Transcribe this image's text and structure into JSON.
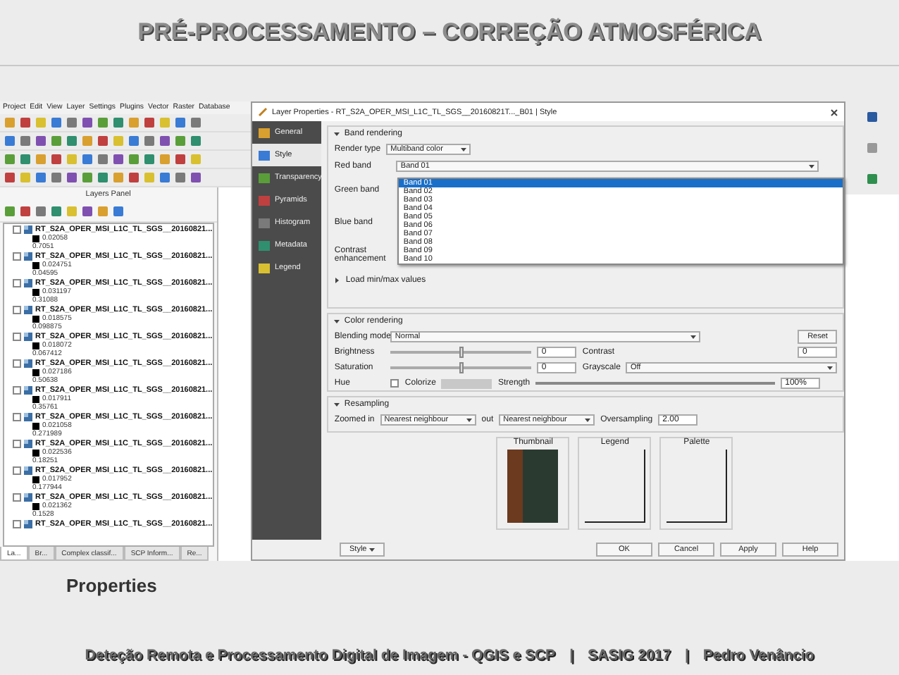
{
  "slide": {
    "title": "PRÉ-PROCESSAMENTO – CORREÇÃO ATMOSFÉRICA",
    "caption": "Properties",
    "footer": [
      "Deteção Remota e Processamento Digital de Imagem - QGIS e SCP",
      "|",
      "SASIG 2017",
      "|",
      "Pedro Venâncio"
    ]
  },
  "qgis": {
    "menu": [
      "Project",
      "Edit",
      "View",
      "Layer",
      "Settings",
      "Plugins",
      "Vector",
      "Raster",
      "Database"
    ],
    "layers_panel": {
      "title": "Layers Panel",
      "layers": [
        {
          "name": "RT_S2A_OPER_MSI_L1C_TL_SGS__20160821...",
          "checked": false,
          "values": [
            "0.02058",
            "0.7051"
          ]
        },
        {
          "name": "RT_S2A_OPER_MSI_L1C_TL_SGS__20160821...",
          "checked": false,
          "values": [
            "0.024751",
            "0.04595"
          ]
        },
        {
          "name": "RT_S2A_OPER_MSI_L1C_TL_SGS__20160821...",
          "checked": false,
          "values": [
            "0.031197",
            "0.31088"
          ]
        },
        {
          "name": "RT_S2A_OPER_MSI_L1C_TL_SGS__20160821...",
          "checked": false,
          "values": [
            "0.018575",
            "0.098875"
          ]
        },
        {
          "name": "RT_S2A_OPER_MSI_L1C_TL_SGS__20160821...",
          "checked": false,
          "values": [
            "0.018072",
            "0.067412"
          ]
        },
        {
          "name": "RT_S2A_OPER_MSI_L1C_TL_SGS__20160821...",
          "checked": false,
          "values": [
            "0.027186",
            "0.50638"
          ]
        },
        {
          "name": "RT_S2A_OPER_MSI_L1C_TL_SGS__20160821...",
          "checked": false,
          "values": [
            "0.017911",
            "0.35761"
          ]
        },
        {
          "name": "RT_S2A_OPER_MSI_L1C_TL_SGS__20160821...",
          "checked": false,
          "values": [
            "0.021058",
            "0.271989"
          ]
        },
        {
          "name": "RT_S2A_OPER_MSI_L1C_TL_SGS__20160821...",
          "checked": false,
          "values": [
            "0.022536",
            "0.18251"
          ]
        },
        {
          "name": "RT_S2A_OPER_MSI_L1C_TL_SGS__20160821...",
          "checked": false,
          "values": [
            "0.017952",
            "0.177944"
          ]
        },
        {
          "name": "RT_S2A_OPER_MSI_L1C_TL_SGS__20160821...",
          "checked": false,
          "values": [
            "0.021362",
            "0.1528"
          ]
        },
        {
          "name": "RT_S2A_OPER_MSI_L1C_TL_SGS__20160821...",
          "checked": false
        }
      ],
      "tabs": [
        {
          "label": "La...",
          "selected": true
        },
        {
          "label": "Br...",
          "selected": false
        },
        {
          "label": "Complex classif...",
          "selected": false
        },
        {
          "label": "SCP Inform...",
          "selected": false
        },
        {
          "label": "Re...",
          "selected": false
        }
      ]
    }
  },
  "dialog": {
    "title": "Layer Properties - RT_S2A_OPER_MSI_L1C_TL_SGS__20160821T..._B01 | Style",
    "sidebar": [
      {
        "label": "General",
        "selected": false
      },
      {
        "label": "Style",
        "selected": true
      },
      {
        "label": "Transparency",
        "selected": false
      },
      {
        "label": "Pyramids",
        "selected": false
      },
      {
        "label": "Histogram",
        "selected": false
      },
      {
        "label": "Metadata",
        "selected": false
      },
      {
        "label": "Legend",
        "selected": false
      }
    ],
    "band_rendering": {
      "title": "Band rendering",
      "render_type_label": "Render type",
      "render_type": "Multiband color",
      "rows": [
        {
          "label": "Red band",
          "value": "Band 01"
        },
        {
          "label": "Green band"
        },
        {
          "label": "Blue band"
        },
        {
          "label": "Contrast enhancement"
        }
      ],
      "band_options": [
        {
          "label": "Band 01",
          "selected": true
        },
        {
          "label": "Band 02",
          "selected": false
        },
        {
          "label": "Band 03",
          "selected": false
        },
        {
          "label": "Band 04",
          "selected": false
        },
        {
          "label": "Band 05",
          "selected": false
        },
        {
          "label": "Band 06",
          "selected": false
        },
        {
          "label": "Band 07",
          "selected": false
        },
        {
          "label": "Band 08",
          "selected": false
        },
        {
          "label": "Band 09",
          "selected": false
        },
        {
          "label": "Band 10",
          "selected": false
        }
      ],
      "minmax": "Load min/max values"
    },
    "color_rendering": {
      "title": "Color rendering",
      "blending_label": "Blending mode",
      "blending": "Normal",
      "reset": "Reset",
      "sliders": [
        {
          "label": "Brightness",
          "level": 0.5,
          "value": "0"
        },
        {
          "label": "Saturation",
          "level": 0.5,
          "value": "0"
        }
      ],
      "contrast_label": "Contrast",
      "contrast": "0",
      "grayscale_label": "Grayscale",
      "grayscale": "Off",
      "hue_label": "Hue",
      "colorize": {
        "label": "Colorize",
        "checked": false
      },
      "strength_label": "Strength",
      "strength": {
        "level": 1
      },
      "strength_value": "100%"
    },
    "resampling": {
      "title": "Resampling",
      "zoomed_in_label": "Zoomed in",
      "zoomed_in": "Nearest neighbour",
      "zoomed_out_label": "out",
      "zoomed_out": "Nearest neighbour",
      "oversampling_label": "Oversampling",
      "oversampling": "2.00"
    },
    "previews": [
      "Thumbnail",
      "Legend",
      "Palette"
    ],
    "style_button": "Style",
    "buttons": [
      "OK",
      "Cancel",
      "Apply",
      "Help"
    ]
  }
}
